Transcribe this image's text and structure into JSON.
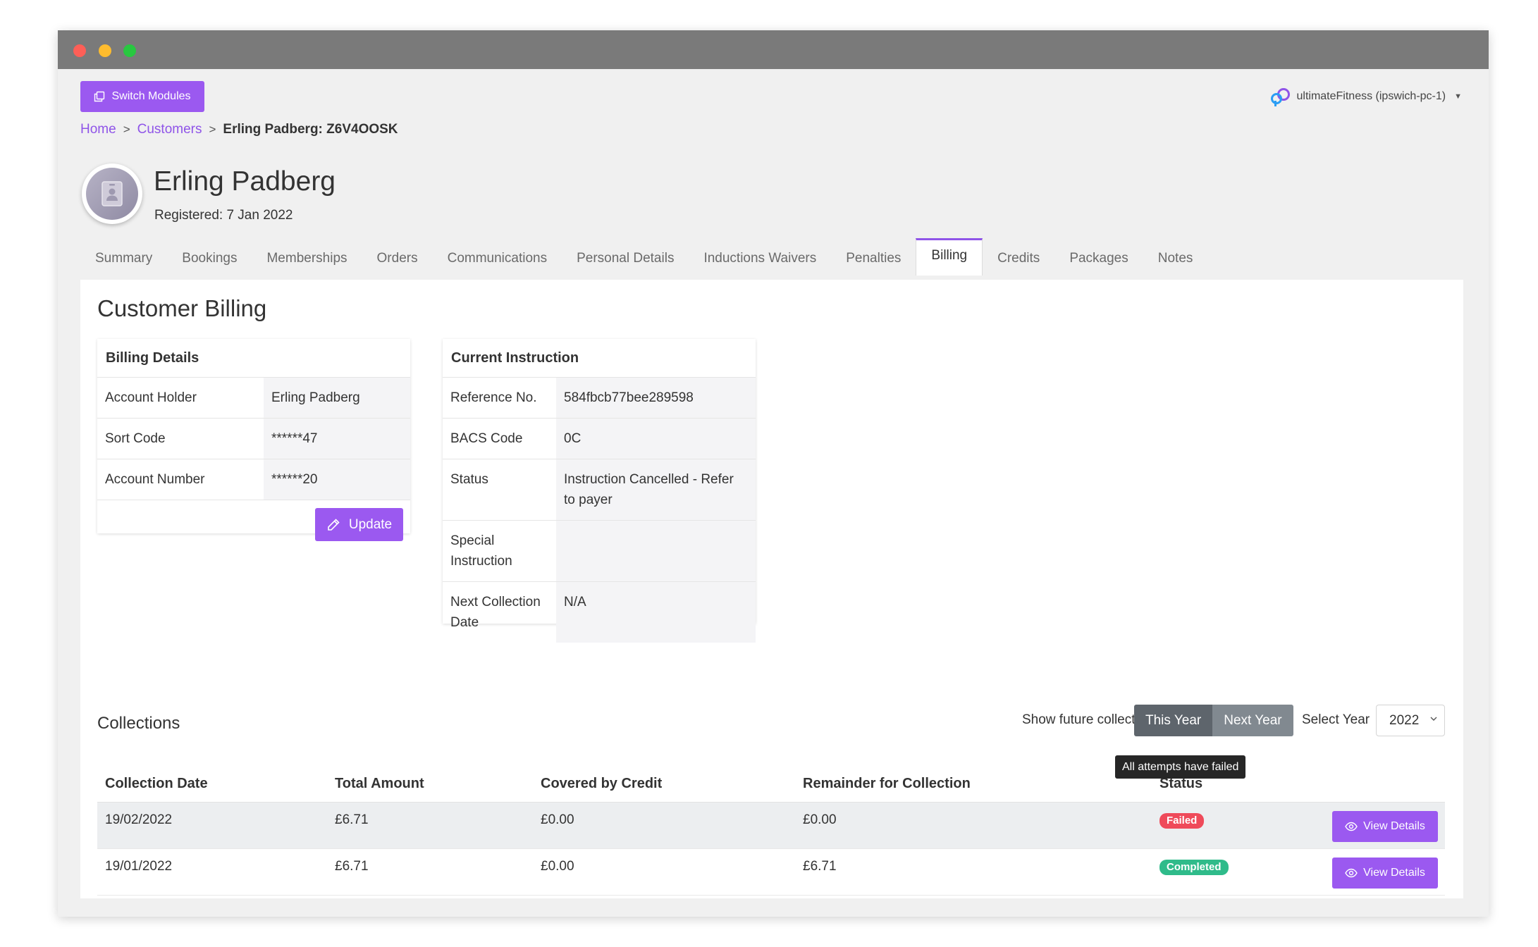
{
  "header": {
    "switch_modules_label": "Switch Modules",
    "tenant_label": "ultimateFitness (ipswich-pc-1)"
  },
  "breadcrumb": {
    "home": "Home",
    "customers": "Customers",
    "separator": ">",
    "current": "Erling Padberg: Z6V4OOSK"
  },
  "customer": {
    "name": "Erling Padberg",
    "registered": "Registered: 7 Jan 2022"
  },
  "tabs": [
    {
      "label": "Summary",
      "active": false
    },
    {
      "label": "Bookings",
      "active": false
    },
    {
      "label": "Memberships",
      "active": false
    },
    {
      "label": "Orders",
      "active": false
    },
    {
      "label": "Communications",
      "active": false
    },
    {
      "label": "Personal Details",
      "active": false
    },
    {
      "label": "Inductions Waivers",
      "active": false
    },
    {
      "label": "Penalties",
      "active": false
    },
    {
      "label": "Billing",
      "active": true
    },
    {
      "label": "Credits",
      "active": false
    },
    {
      "label": "Packages",
      "active": false
    },
    {
      "label": "Notes",
      "active": false
    }
  ],
  "billing": {
    "page_title": "Customer Billing",
    "details_title": "Billing Details",
    "details": [
      {
        "label": "Account Holder",
        "value": "Erling Padberg"
      },
      {
        "label": "Sort Code",
        "value": "******47"
      },
      {
        "label": "Account Number",
        "value": "******20"
      }
    ],
    "update_label": "Update"
  },
  "instruction": {
    "title": "Current Instruction",
    "rows": [
      {
        "label": "Reference No.",
        "value": "584fbcb77bee289598"
      },
      {
        "label": "BACS Code",
        "value": "0C"
      },
      {
        "label": "Status",
        "value": "Instruction Cancelled - Refer to payer"
      },
      {
        "label": "Special Instruction",
        "value": ""
      },
      {
        "label": "Next Collection Date",
        "value": "N/A"
      }
    ]
  },
  "collections": {
    "title": "Collections",
    "show_future_label": "Show future collections",
    "show_future_checked": false,
    "this_year_label": "This Year",
    "next_year_label": "Next Year",
    "select_year_label": "Select Year",
    "selected_year": "2022",
    "columns": [
      "Collection Date",
      "Total Amount",
      "Covered by Credit",
      "Remainder for Collection",
      "Status",
      ""
    ],
    "rows": [
      {
        "date": "19/02/2022",
        "total": "£6.71",
        "credit": "£0.00",
        "remainder": "£0.00",
        "status": "Failed",
        "action": "View Details"
      },
      {
        "date": "19/01/2022",
        "total": "£6.71",
        "credit": "£0.00",
        "remainder": "£6.71",
        "status": "Completed",
        "action": "View Details"
      }
    ],
    "tooltip": "All attempts have failed"
  },
  "colors": {
    "accent": "#9b59f0",
    "link": "#8f54e8",
    "failed": "#ef4a5a",
    "completed": "#2fbb8a"
  }
}
